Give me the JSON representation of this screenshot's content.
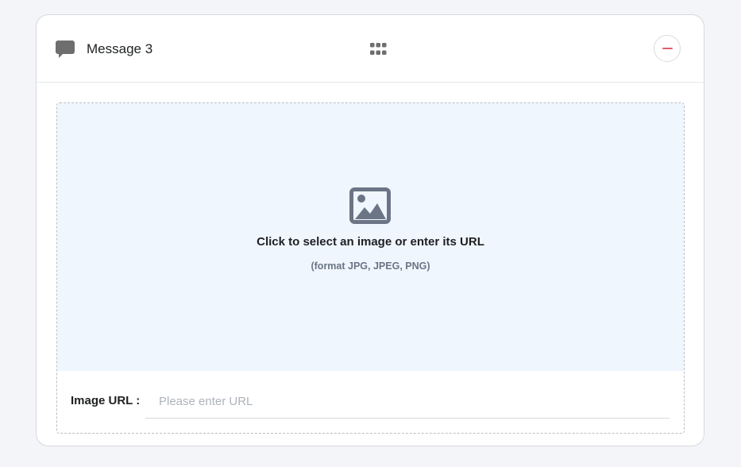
{
  "header": {
    "title": "Message 3",
    "icons": {
      "message": "speech-bubble-icon",
      "drag": "grid-dots-icon",
      "remove": "minus-circle-icon"
    }
  },
  "upload": {
    "title": "Click to select an image or enter its URL",
    "subtitle": "(format JPG, JPEG, PNG)",
    "icon": "image-icon"
  },
  "url_field": {
    "label": "Image URL :",
    "value": "",
    "placeholder": "Please enter URL"
  },
  "colors": {
    "icon_gray": "#6e6e6e",
    "image_icon": "#6b7585",
    "remove_red": "#e35d6a",
    "drop_bg": "#f0f6fe",
    "page_bg": "#f3f5f8"
  }
}
